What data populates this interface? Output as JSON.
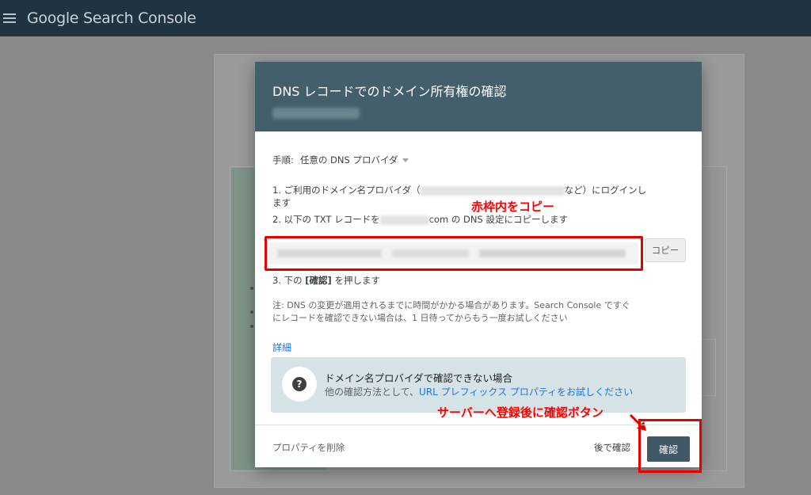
{
  "appbar": {
    "menu_icon": "menu-icon",
    "title": "Google Search Console"
  },
  "dialog": {
    "title": "DNS レコードでのドメイン所有権の確認",
    "steps_label": "手順:",
    "provider_selected": "任意の DNS プロバイダ",
    "step1_a": "1. ご利用のドメイン名プロバイダ（",
    "step1_b": "など）にログインし",
    "step1_c": "ます",
    "step2_a": "2. 以下の TXT レコードを",
    "step2_b": "com の DNS 設定にコピーします",
    "copy_label": "コピー",
    "step3_a": "3. 下の",
    "step3_b": "[確認]",
    "step3_c": "を押します",
    "note_line1": "注: DNS の変更が適用されるまでに時間がかかる場合があります。Search Console ですぐ",
    "note_line2": "にレコードを確認できない場合は、1 日待ってからもう一度お試しください",
    "details_link": "詳細",
    "help_title": "ドメイン名プロバイダで確認できない場合",
    "help_text_a": "他の確認方法として、",
    "help_text_link": "URL プレフィックス プロパティをお試しください",
    "delete_label": "プロパティを削除",
    "later_label": "後で確認",
    "confirm_label": "確認"
  },
  "annotations": {
    "copy_note": "赤枠内をコピー",
    "confirm_note": "サーバーへ登録後に確認ボタン",
    "color": "#ff0000"
  },
  "colors": {
    "appbar_bg": "#1f3440",
    "dialog_header_bg": "#435f6b",
    "confirm_bg": "#3f5a66",
    "link": "#1a73e8",
    "help_bg": "#d6e3e6"
  }
}
